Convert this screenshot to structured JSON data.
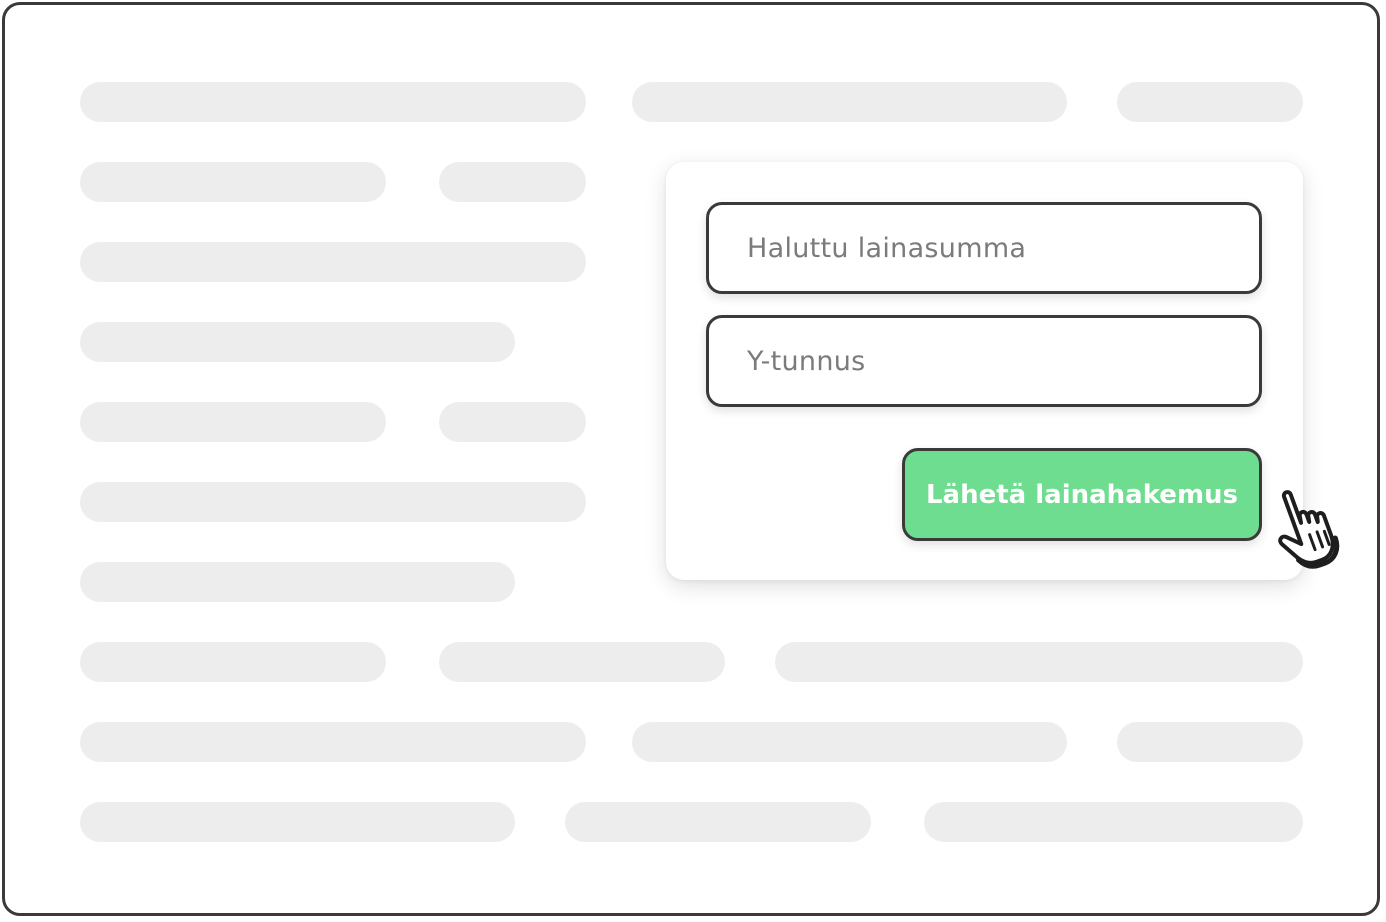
{
  "form": {
    "amount_placeholder": "Haluttu lainasumma",
    "amount_value": "",
    "business_id_placeholder": "Y-tunnus",
    "business_id_value": "",
    "submit_label": "Lähetä lainahakemus"
  },
  "icons": {
    "cursor": "hand-pointer-icon"
  },
  "colors": {
    "frame_border": "#3a3a3a",
    "placeholder_bar": "#ededed",
    "submit_background": "#6edd90",
    "submit_text": "#ffffff",
    "placeholder_text": "#7b7b7b"
  }
}
